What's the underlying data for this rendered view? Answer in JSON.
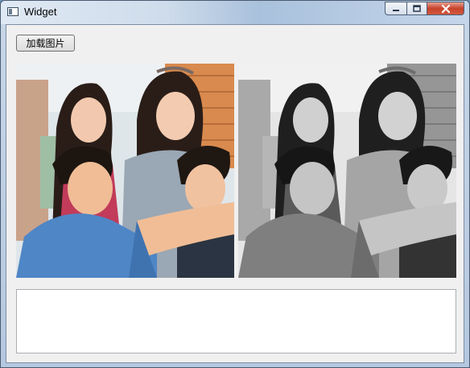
{
  "window": {
    "title": "Widget",
    "accent_close": "#c7432b"
  },
  "toolbar": {
    "load_image_label": "加载图片"
  },
  "images": {
    "original": {
      "icon": "photo-color"
    },
    "processed": {
      "icon": "photo-grayscale"
    }
  },
  "output": {
    "text": ""
  }
}
